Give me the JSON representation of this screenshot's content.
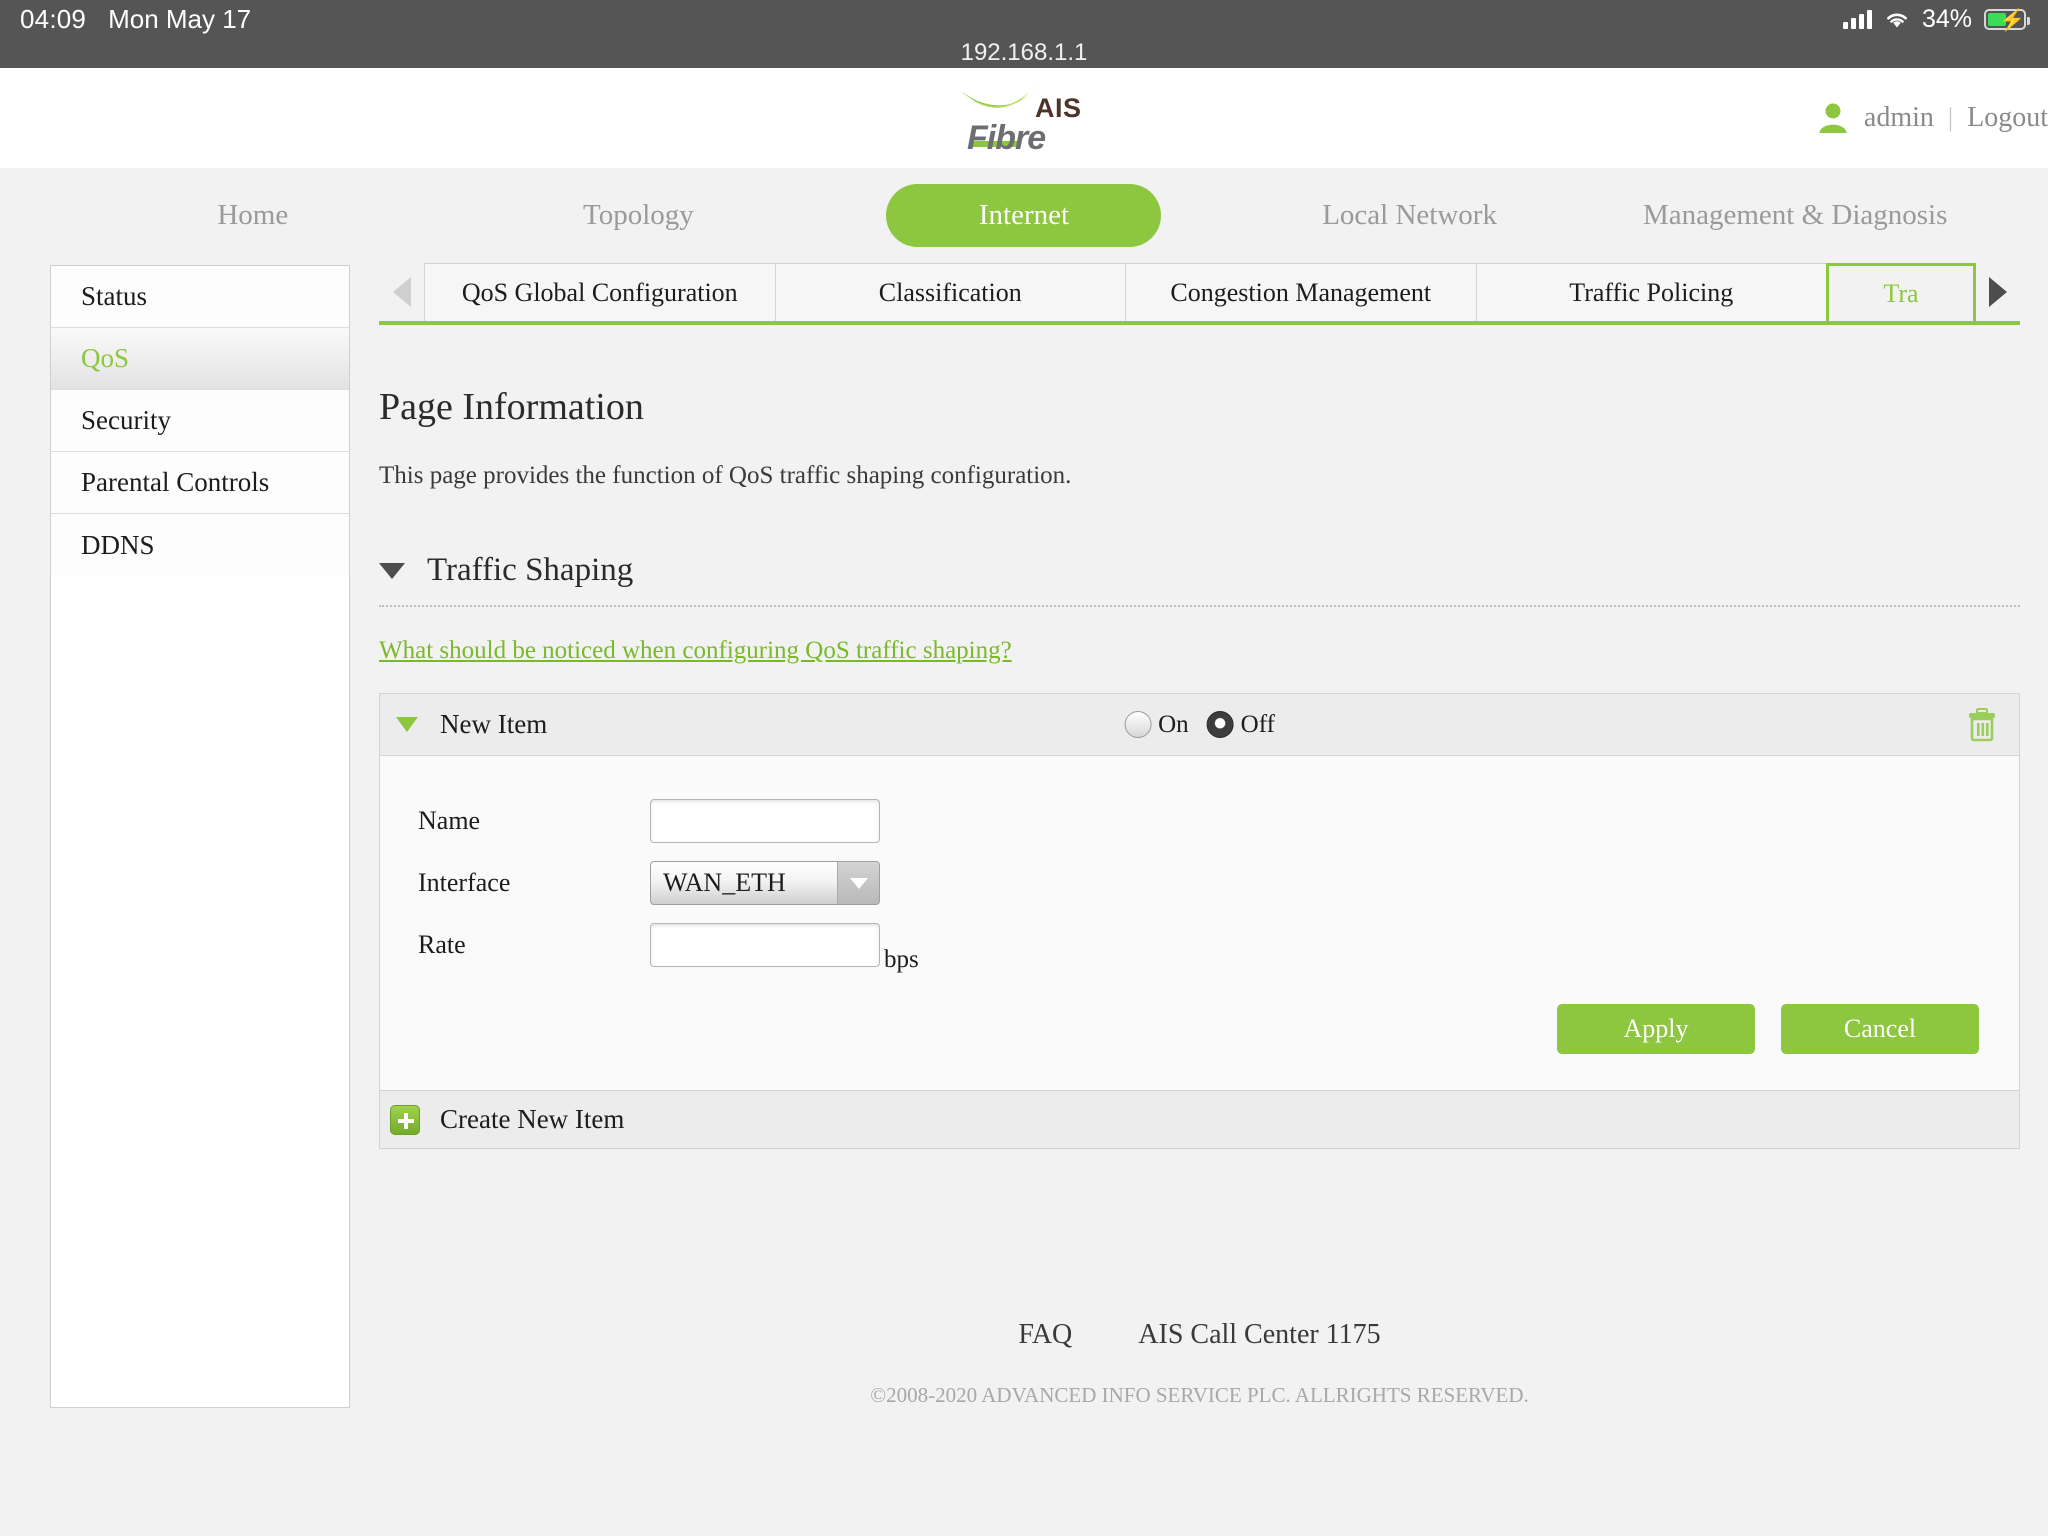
{
  "statusbar": {
    "time": "04:09",
    "date": "Mon May 17",
    "battery_percent": "34%",
    "icons": [
      "signal-bars-icon",
      "wifi-icon",
      "battery-charging-icon"
    ]
  },
  "browser": {
    "url": "192.168.1.1"
  },
  "header": {
    "logo_primary": "AIS",
    "logo_secondary": "Fibre",
    "user": "admin",
    "divider": "|",
    "logout": "Logout"
  },
  "mainnav": {
    "items": [
      {
        "label": "Home",
        "active": false
      },
      {
        "label": "Topology",
        "active": false
      },
      {
        "label": "Internet",
        "active": true
      },
      {
        "label": "Local Network",
        "active": false
      },
      {
        "label": "Management & Diagnosis",
        "active": false
      }
    ]
  },
  "sidebar": {
    "items": [
      {
        "label": "Status",
        "active": false
      },
      {
        "label": "QoS",
        "active": true
      },
      {
        "label": "Security",
        "active": false
      },
      {
        "label": "Parental Controls",
        "active": false
      },
      {
        "label": "DDNS",
        "active": false
      }
    ]
  },
  "subtabs": {
    "prev_arrow": "chevron-left-icon",
    "next_arrow": "chevron-right-icon",
    "items": [
      {
        "label": "QoS Global Configuration",
        "active": false
      },
      {
        "label": "Classification",
        "active": false
      },
      {
        "label": "Congestion Management",
        "active": false
      },
      {
        "label": "Traffic Policing",
        "active": false
      },
      {
        "label": "Tra",
        "active": true
      }
    ]
  },
  "main": {
    "page_info_title": "Page Information",
    "page_info_desc": "This page provides the function of QoS traffic shaping configuration.",
    "section_title": "Traffic Shaping",
    "hint_link": "What should be noticed when configuring QoS traffic shaping?",
    "item": {
      "title": "New Item",
      "radio_on_label": "On",
      "radio_off_label": "Off",
      "selected": "Off",
      "fields": [
        {
          "label": "Name",
          "type": "text",
          "value": "",
          "unit": ""
        },
        {
          "label": "Interface",
          "type": "select",
          "value": "WAN_ETH",
          "unit": ""
        },
        {
          "label": "Rate",
          "type": "text",
          "value": "",
          "unit": "bps"
        }
      ],
      "apply_label": "Apply",
      "cancel_label": "Cancel",
      "delete_icon": "trash-icon"
    },
    "create_new_label": "Create New Item",
    "create_new_icon": "plus-icon"
  },
  "footer": {
    "links": [
      "FAQ",
      "AIS Call Center 1175"
    ],
    "copyright": "©2008-2020 ADVANCED INFO SERVICE PLC. ALLRIGHTS RESERVED."
  },
  "colors": {
    "brand_green": "#8dc63f",
    "link_green": "#7ab929",
    "statusbar_gray": "#555555",
    "page_bg": "#f2f2f2"
  }
}
